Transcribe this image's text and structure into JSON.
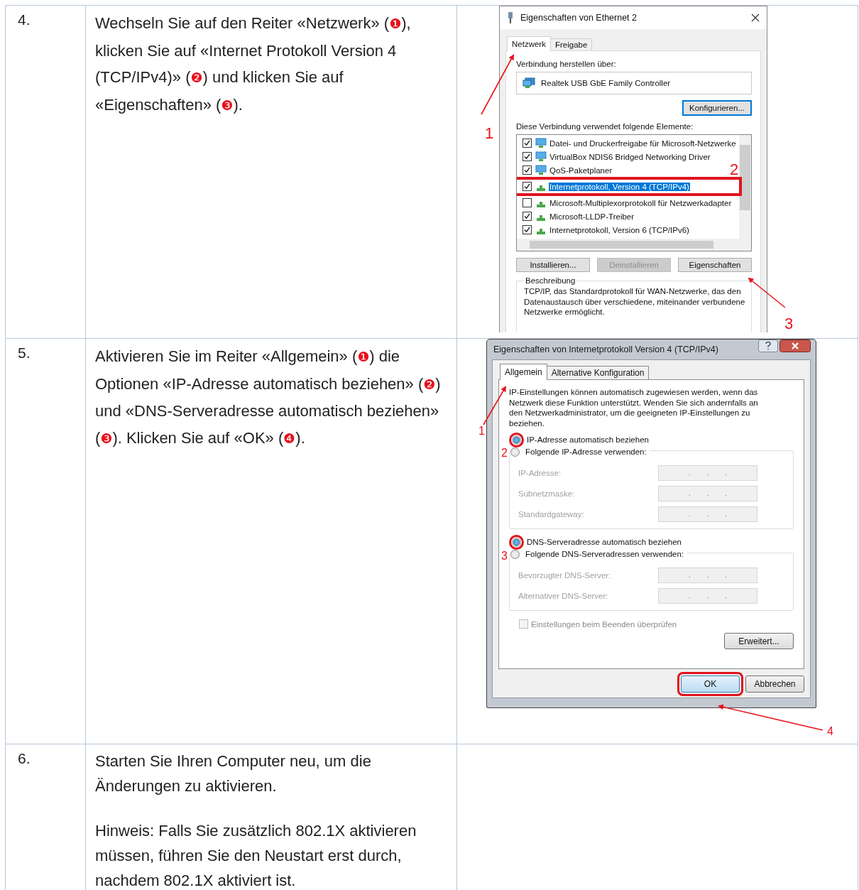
{
  "rows": [
    {
      "number": "4.",
      "paragraphs": [
        [
          {
            "kind": "plain",
            "text": "Wechseln Sie auf den Reiter «Netzwerk» ("
          },
          {
            "kind": "marker",
            "text": "❶"
          },
          {
            "kind": "plain",
            "text": "), klicken Sie auf «Internet Protokoll Version 4 (TCP/IPv4)» ("
          },
          {
            "kind": "marker",
            "text": "❷"
          },
          {
            "kind": "plain",
            "text": ") und klicken Sie auf «Eigenschaften» ("
          },
          {
            "kind": "marker",
            "text": "❸"
          },
          {
            "kind": "plain",
            "text": ")."
          }
        ]
      ],
      "dialog": {
        "kind": "ethernet_properties",
        "title": "Eigenschaften von Ethernet 2",
        "tabs": [
          {
            "label": "Netzwerk",
            "selected": true
          },
          {
            "label": "Freigabe",
            "selected": false
          }
        ],
        "connect_label": "Verbindung herstellen über:",
        "adapter": "Realtek USB GbE Family Controller",
        "configure_button": "Konfigurieren...",
        "items_label": "Diese Verbindung verwendet folgende Elemente:",
        "items": [
          {
            "label": "Datei- und Druckerfreigabe für Microsoft-Netzwerke",
            "kind": "client",
            "checked": true,
            "selected": false,
            "highlighted": false
          },
          {
            "label": "VirtualBox NDIS6 Bridged Networking Driver",
            "kind": "client",
            "checked": true,
            "selected": false,
            "highlighted": false
          },
          {
            "label": "QoS-Paketplaner",
            "kind": "client",
            "checked": true,
            "selected": false,
            "highlighted": false
          },
          {
            "label": "Internetprotokoll, Version 4 (TCP/IPv4)",
            "kind": "protocol",
            "checked": true,
            "selected": true,
            "highlighted": true
          },
          {
            "label": "Microsoft-Multiplexorprotokoll für Netzwerkadapter",
            "kind": "protocol",
            "checked": false,
            "selected": false,
            "highlighted": false
          },
          {
            "label": "Microsoft-LLDP-Treiber",
            "kind": "protocol",
            "checked": true,
            "selected": false,
            "highlighted": false
          },
          {
            "label": "Internetprotokoll, Version 6 (TCP/IPv6)",
            "kind": "protocol",
            "checked": true,
            "selected": false,
            "highlighted": false
          }
        ],
        "buttons": [
          {
            "label": "Installieren...",
            "disabled": false
          },
          {
            "label": "Deinstallieren",
            "disabled": true
          },
          {
            "label": "Eigenschaften",
            "disabled": false
          }
        ],
        "description": {
          "title": "Beschreibung",
          "text": "TCP/IP, das Standardprotokoll für WAN-Netzwerke, das den Datenaustausch über verschiedene, miteinander verbundene Netzwerke ermöglicht."
        },
        "annotations": [
          {
            "label": "1"
          },
          {
            "label": "2"
          },
          {
            "label": "3"
          }
        ]
      }
    },
    {
      "number": "5.",
      "paragraphs": [
        [
          {
            "kind": "plain",
            "text": "Aktivieren Sie im Reiter «Allgemein» ("
          },
          {
            "kind": "marker",
            "text": "❶"
          },
          {
            "kind": "plain",
            "text": ") die Optionen «IP-Adresse automatisch beziehen» ("
          },
          {
            "kind": "marker",
            "text": "❷"
          },
          {
            "kind": "plain",
            "text": ") und «DNS-Serveradresse automatisch beziehen» ("
          },
          {
            "kind": "marker",
            "text": "❸"
          },
          {
            "kind": "plain",
            "text": "). Klicken Sie auf «OK» ("
          },
          {
            "kind": "marker",
            "text": "❹"
          },
          {
            "kind": "plain",
            "text": ")."
          }
        ]
      ],
      "dialog": {
        "kind": "ipv4_properties",
        "title": "Eigenschaften von Internetprotokoll Version 4 (TCP/IPv4)",
        "tabs": [
          {
            "label": "Allgemein",
            "selected": true
          },
          {
            "label": "Alternative Konfiguration",
            "selected": false
          }
        ],
        "intro": "IP-Einstellungen können automatisch zugewiesen werden, wenn das Netzwerk diese Funktion unterstützt. Wenden Sie sich andernfalls an den Netzwerkadministrator, um die geeigneten IP-Einstellungen zu beziehen.",
        "groups": [
          {
            "options": [
              {
                "label": "IP-Adresse automatisch beziehen",
                "selected": true,
                "highlighted": true
              },
              {
                "label": "Folgende IP-Adresse verwenden:",
                "selected": false,
                "highlighted": false
              }
            ],
            "fields": [
              {
                "label": "IP-Adresse:",
                "value": ".       .       .",
                "disabled": true
              },
              {
                "label": "Subnetzmaske:",
                "value": ".       .       .",
                "disabled": true
              },
              {
                "label": "Standardgateway:",
                "value": ".       .       .",
                "disabled": true
              }
            ]
          },
          {
            "options": [
              {
                "label": "DNS-Serveradresse automatisch beziehen",
                "selected": true,
                "highlighted": true
              },
              {
                "label": "Folgende DNS-Serveradressen verwenden:",
                "selected": false,
                "highlighted": false
              }
            ],
            "fields": [
              {
                "label": "Bevorzugter DNS-Server:",
                "value": ".       .       .",
                "disabled": true
              },
              {
                "label": "Alternativer DNS-Server:",
                "value": ".       .       .",
                "disabled": true
              }
            ]
          }
        ],
        "validate_checkbox": {
          "label": "Einstellungen beim Beenden überprüfen",
          "checked": false,
          "disabled": true
        },
        "advanced_button": "Erweitert...",
        "buttons": [
          {
            "label": "OK",
            "highlighted": true
          },
          {
            "label": "Abbrechen",
            "highlighted": false
          }
        ],
        "annotations": [
          {
            "label": "1"
          },
          {
            "label": "2"
          },
          {
            "label": "3"
          },
          {
            "label": "4"
          }
        ]
      }
    },
    {
      "number": "6.",
      "paragraphs": [
        [
          {
            "kind": "plain",
            "text": "Starten Sie Ihren Computer neu, um die Änderungen zu aktivieren."
          }
        ],
        [
          {
            "kind": "plain",
            "text": "Hinweis: Falls Sie zusätzlich 802.1X aktivieren müssen, führen Sie den Neustart erst durch, nachdem 802.1X aktiviert ist."
          }
        ]
      ]
    }
  ]
}
